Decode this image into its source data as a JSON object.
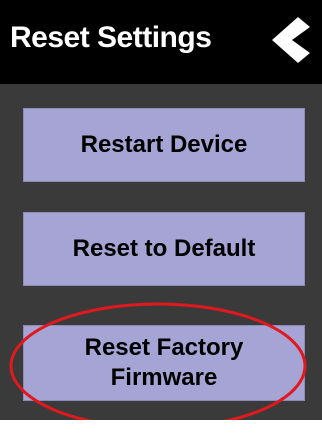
{
  "header": {
    "title": "Reset Settings",
    "back_icon": "chevron-left-icon"
  },
  "actions": {
    "restart_label": "Restart Device",
    "reset_default_label": "Reset to Default",
    "factory_line1": "Reset Factory",
    "factory_line2": "Firmware"
  },
  "annotation": {
    "highlight_color": "#e0191e",
    "highlighted_item": "Reset Factory Firmware"
  },
  "colors": {
    "header_bg": "#000000",
    "screen_bg": "#3a3a3a",
    "button_bg": "#a6a4d4",
    "text_light": "#ffffff",
    "text_dark": "#000000"
  }
}
